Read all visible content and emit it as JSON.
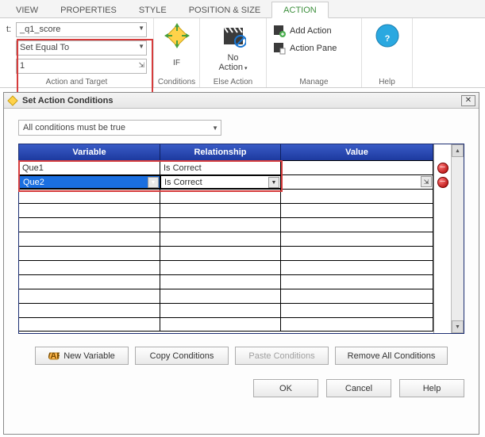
{
  "tabs": {
    "view": "VIEW",
    "properties": "PROPERTIES",
    "style": "STYLE",
    "position": "POSITION & SIZE",
    "action": "ACTION"
  },
  "action_target": {
    "t_label": "t:",
    "target": "_q1_score",
    "op": "Set Equal To",
    "value": "1",
    "group_title": "Action and Target"
  },
  "conditions": {
    "if_label": "IF",
    "group_title": "Conditions"
  },
  "else": {
    "label_line1": "No",
    "label_line2": "Action",
    "group_title": "Else Action"
  },
  "manage": {
    "add": "Add Action",
    "pane": "Action Pane",
    "group_title": "Manage"
  },
  "help": {
    "label": "Help"
  },
  "dialog": {
    "title": "Set Action Conditions",
    "mode": "All conditions must be true",
    "headers": {
      "variable": "Variable",
      "relationship": "Relationship",
      "value": "Value"
    },
    "rows": [
      {
        "variable": "Que1",
        "relationship": "Is Correct",
        "value": ""
      },
      {
        "variable": "Que2",
        "relationship": "Is Correct",
        "value": ""
      }
    ],
    "buttons": {
      "new_var": "New Variable",
      "copy": "Copy Conditions",
      "paste": "Paste Conditions",
      "remove": "Remove All Conditions",
      "ok": "OK",
      "cancel": "Cancel",
      "help": "Help"
    }
  }
}
